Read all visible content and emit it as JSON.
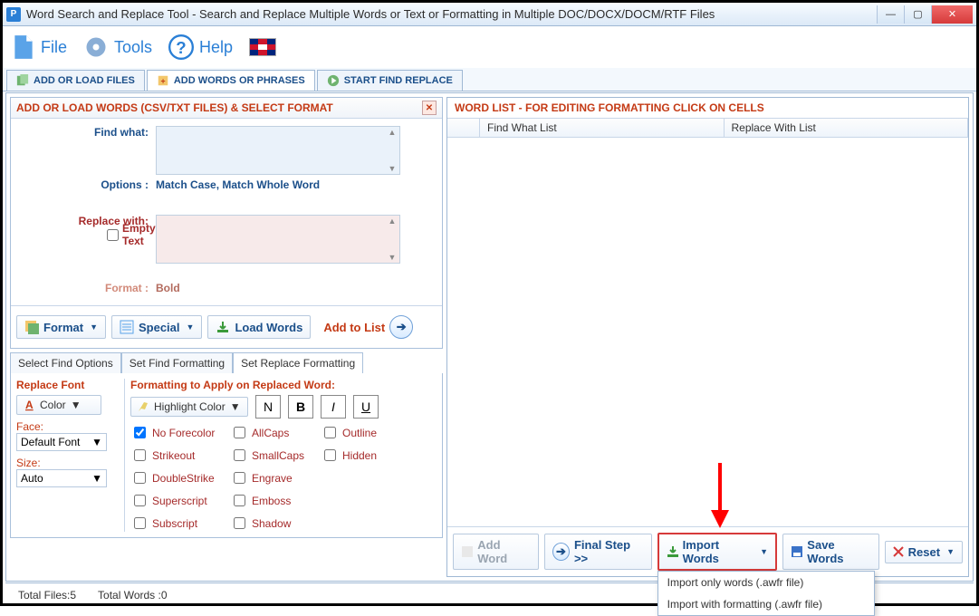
{
  "window": {
    "title": "Word Search and Replace Tool - Search and Replace Multiple Words or Text  or Formatting in Multiple DOC/DOCX/DOCM/RTF Files"
  },
  "menu": {
    "file": "File",
    "tools": "Tools",
    "help": "Help"
  },
  "tabs": {
    "t1": "ADD OR LOAD FILES",
    "t2": "ADD WORDS OR PHRASES",
    "t3": "START FIND REPLACE"
  },
  "left": {
    "panel_title": "ADD OR LOAD WORDS (CSV/TXT FILES) & SELECT FORMAT",
    "find_label": "Find what:",
    "options_label": "Options :",
    "options_value": "Match Case, Match Whole Word",
    "replace_label": "Replace with:",
    "empty_text": "Empty Text",
    "format_label": "Format :",
    "format_value": "Bold",
    "toolbar": {
      "format": "Format",
      "special": "Special",
      "load_words": "Load Words",
      "add_to_list": "Add to List"
    },
    "subtabs": {
      "t1": "Select Find Options",
      "t2": "Set Find Formatting",
      "t3": "Set Replace Formatting"
    },
    "replace_font": {
      "header": "Replace Font",
      "color_btn": "Color",
      "face_label": "Face:",
      "face_value": "Default Font",
      "size_label": "Size:",
      "size_value": "Auto"
    },
    "format_apply": {
      "header": "Formatting to Apply on Replaced Word:",
      "highlight": "Highlight Color",
      "N": "N",
      "B": "B",
      "I": "I",
      "U": "U",
      "no_forecolor": "No Forecolor",
      "strikeout": "Strikeout",
      "doublestrike": "DoubleStrike",
      "superscript": "Superscript",
      "subscript": "Subscript",
      "allcaps": "AllCaps",
      "smallcaps": "SmallCaps",
      "engrave": "Engrave",
      "emboss": "Emboss",
      "shadow": "Shadow",
      "outline": "Outline",
      "hidden": "Hidden"
    }
  },
  "right": {
    "header": "WORD LIST - FOR EDITING FORMATTING CLICK ON CELLS",
    "col1": "Find What List",
    "col2": "Replace With List",
    "toolbar": {
      "add_word": "Add Word",
      "final_step": "Final Step >>",
      "import_words": "Import Words",
      "save_words": "Save Words",
      "reset": "Reset"
    },
    "import_menu": {
      "m1": "Import only words (.awfr file)",
      "m2": "Import with formatting (.awfr file)"
    }
  },
  "status": {
    "files": "Total Files:5",
    "words": "Total Words :0"
  }
}
